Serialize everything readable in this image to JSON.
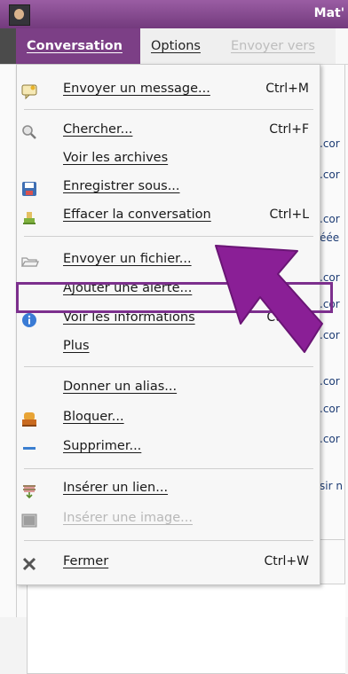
{
  "window": {
    "title": "Mat'"
  },
  "menubar": {
    "items": [
      {
        "label": "Conversation",
        "active": true
      },
      {
        "label": "Options",
        "active": false
      },
      {
        "label": "Envoyer vers",
        "active": false,
        "disabled": true
      }
    ]
  },
  "chat": {
    "snippets": [
      ".cor",
      ".cor",
      ".cor",
      "éée",
      ".cor",
      ".cor",
      ".cor",
      ".cor",
      ".cor",
      ".cor",
      "sir n"
    ]
  },
  "dropdown": {
    "items": [
      {
        "label": "Envoyer un message...",
        "shortcut": "Ctrl+M",
        "icon": "message-icon"
      },
      {
        "label": "Chercher...",
        "shortcut": "Ctrl+F",
        "icon": "search-icon"
      },
      {
        "label": "Voir les archives",
        "shortcut": "",
        "icon": ""
      },
      {
        "label": "Enregistrer sous...",
        "shortcut": "",
        "icon": "save-icon"
      },
      {
        "label": "Effacer la conversation",
        "shortcut": "Ctrl+L",
        "icon": "clear-icon"
      },
      {
        "label": "Envoyer un fichier...",
        "shortcut": "",
        "icon": "folder-icon"
      },
      {
        "label": "Ajouter une alerte...",
        "shortcut": "",
        "icon": ""
      },
      {
        "label": "Voir les informations",
        "shortcut": "Ctrl+O",
        "icon": "info-icon"
      },
      {
        "label": "Plus",
        "shortcut": "",
        "icon": ""
      },
      {
        "label": "Donner un alias...",
        "shortcut": "",
        "icon": ""
      },
      {
        "label": "Bloquer...",
        "shortcut": "",
        "icon": "block-icon"
      },
      {
        "label": "Supprimer...",
        "shortcut": "",
        "icon": "remove-icon"
      },
      {
        "label": "Insérer un lien...",
        "shortcut": "",
        "icon": "link-icon"
      },
      {
        "label": "Insérer une image...",
        "shortcut": "",
        "icon": "image-icon",
        "disabled": true
      },
      {
        "label": "Fermer",
        "shortcut": "Ctrl+W",
        "icon": "close-icon"
      }
    ]
  },
  "annotation": {
    "highlight_color": "#7c2f8d",
    "highlighted_item": "Envoyer un fichier..."
  }
}
